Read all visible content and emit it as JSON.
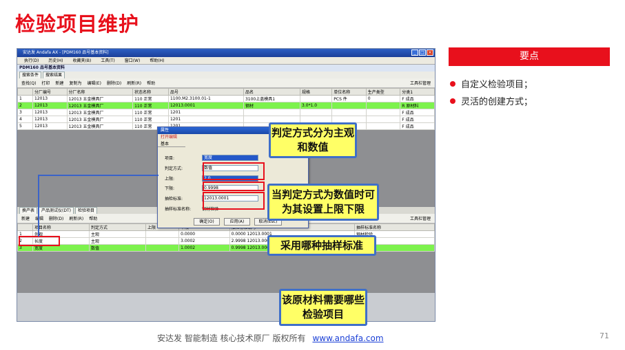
{
  "title": "检验项目维护",
  "panel": {
    "heading": "要点",
    "bullets": [
      "自定义检验项目；",
      "灵活的创建方式；"
    ]
  },
  "footer": {
    "text": "安达发   智能制造 核心技术原厂   版权所有",
    "link": "www.andafa.com"
  },
  "page_number": "71",
  "app": {
    "window_title": "安达发 Andafa AX - [PDM160 品号基本资料]",
    "menus": [
      "执行(D)",
      "历史(H)",
      "收藏夹(B)",
      "工具(T)",
      "窗口(W)",
      "帮助(H)"
    ],
    "sub_title": "PDM160 品号基本资料",
    "tabs": [
      "搜索条件",
      "搜索结果"
    ],
    "toolbar": [
      "查找(Q)",
      "打印",
      "新建",
      "复制为",
      "编辑(E)",
      "删除(D)",
      "刷新(R)",
      "帮助"
    ],
    "toolbar_right": "工具栏管理",
    "grid_headers": [
      "分厂编号",
      "分厂名称",
      "状态名称",
      "品号",
      "品名",
      "规格",
      "单位名称",
      "生产类型",
      "分类1"
    ],
    "grid_rows": [
      [
        "1",
        "12013",
        "12013 五金模具厂",
        "110 正常",
        "1100.M2.3100.01-1",
        "3100上盖模具1",
        "",
        "PCS 件",
        "0",
        "F 成品"
      ],
      [
        "2",
        "12013",
        "12013 五金模具厂",
        "110 正常",
        "12013.0001",
        "钢材",
        "3.0*1.0",
        "",
        "",
        "R 原材料"
      ],
      [
        "3",
        "12013",
        "12013 五金模具厂",
        "110 正常",
        "1201",
        "",
        "",
        "",
        "",
        "F 成品"
      ],
      [
        "4",
        "12013",
        "12013 五金模具厂",
        "110 正常",
        "1201",
        "",
        "",
        "",
        "",
        "F 成品"
      ],
      [
        "5",
        "12013",
        "12013 五金模具厂",
        "110 正常",
        "1201",
        "",
        "",
        "",
        "",
        "F 成品"
      ]
    ],
    "dialog": {
      "title": "属性",
      "sub": "打开编辑",
      "tab": "基本",
      "fields": [
        {
          "label": "项目:",
          "value": "宽度"
        },
        {
          "label": "判定方式:",
          "value": "数值"
        },
        {
          "label": "上限:",
          "value": "2.0"
        },
        {
          "label": "下限:",
          "value": "0.9998"
        },
        {
          "label": "抽检标准:",
          "value": "12013.0001"
        },
        {
          "label": "抽样标准名称:",
          "value": "钢材检验"
        }
      ],
      "buttons": [
        "确定(O)",
        "应用(A)",
        "取消(Esc)"
      ]
    },
    "bottom_tabs": [
      "换产表",
      "产品测试仪(DT)",
      "检验项目"
    ],
    "bottom_toolbar": [
      "新建",
      "编辑",
      "删除(D)",
      "刷新(R)",
      "帮助"
    ],
    "bottom_headers": [
      "项目名称",
      "判定方式",
      "上限",
      "下限",
      "抽检标准编号",
      "抽样标准名称"
    ],
    "bottom_rows": [
      [
        "1",
        "外观",
        "主观",
        "",
        "0.0000",
        "0.0000 12013.0001",
        "钢材检验"
      ],
      [
        "2",
        "长度",
        "主观",
        "",
        "3.0002",
        "2.9998 12013.0001",
        "钢材检验"
      ],
      [
        "3",
        "宽度",
        "数值",
        "",
        "1.0002",
        "0.9998 12013.0001",
        "钢材检验"
      ]
    ]
  },
  "callouts": [
    "判定方式分为主观和数值",
    "当判定方式为数值时可为其设置上限下限",
    "采用哪种抽样标准",
    "该原材料需要哪些检验项目"
  ]
}
